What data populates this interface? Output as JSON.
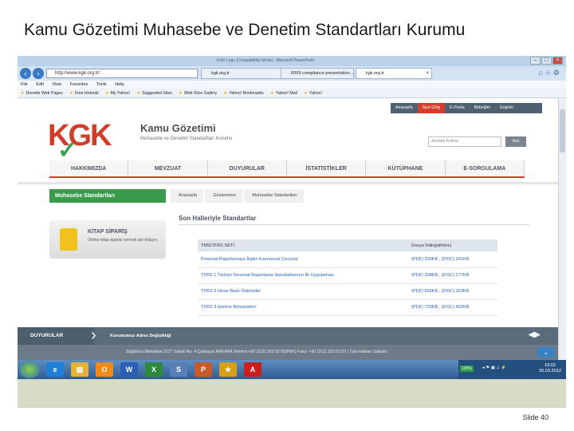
{
  "slide": {
    "title": "Kamu Gözetimi Muhasebe ve Denetim Standartları Kurumu",
    "number": "Slide 40"
  },
  "browser": {
    "window_title": "KGK Logo (Compatibility Mode) - Microsoft PowerPoint",
    "address": "http://www.kgk.org.tr/",
    "tabs": [
      {
        "label": "kgk.org.tr",
        "active": false
      },
      {
        "label": "IFRS compliance presentation...",
        "active": false
      },
      {
        "label": "kgk.org.tr",
        "active": true
      }
    ],
    "menu": [
      "File",
      "Edit",
      "View",
      "Favorites",
      "Tools",
      "Help"
    ],
    "favorites": [
      "Denetle Web Pages",
      "Free Hotmail",
      "My Yahoo!",
      "Suggested Sites",
      "Web Slice Gallery",
      "Yahoo! Bookmarks",
      "Yahoo! Mail",
      "Yahoo!"
    ]
  },
  "site": {
    "top_nav": [
      "Anasayfa",
      "Siye Gİriş",
      "E-Posta",
      "Bebeğim",
      "English"
    ],
    "logo": "KGK",
    "org_title": "Kamu Gözetimi",
    "org_subtitle": "Muhasebe ve Denetim Standartları Kurumu",
    "search_placeholder": "Anahtar Kelime",
    "search_button": "Ara",
    "main_nav": [
      "HAKKIMIZDA",
      "MEVZUAT",
      "DUYURULAR",
      "İSTATİSTİKLER",
      "KÜTÜPHANE",
      "E-SORGULAMA"
    ],
    "side_heading": "Muhasebe Standartları",
    "breadcrumbs": [
      "Anasayfa",
      "Gözlemmer",
      "Muhasebe Standartları"
    ],
    "kitap": {
      "title": "KİTAP SİPARİŞ",
      "subtitle": "Online kitap siparişi vermek için tıklayın."
    },
    "content_title": "Son Halleriyle Standartlar",
    "table": {
      "headers": [
        "TMS/TFRS SETİ",
        "Dosya İndir(pdf/doc)"
      ],
      "rows": [
        {
          "name": "Finansal Raporlamaya İlişkin Kavramsal Çerçeve",
          "size": "(PDF) 330KB , (DOC) 241KB"
        },
        {
          "name": "TFRS 1 Türkiye Finansal Raporlama Standartlarının İlk Uygulaması",
          "size": "(PDF) 338KB , (DOC) 277KB"
        },
        {
          "name": "TFRS 2 Hisse Bazlı Ödemeler",
          "size": "(PDF) 650KB , (DOC) 323KB"
        },
        {
          "name": "TFRS 3 İşletme Birleşmeleri",
          "size": "(PDF) 720KB , (DOC) 402KB"
        }
      ]
    },
    "footer": {
      "section": "DUYURULAR",
      "news": "Kurumumuz Adres Değişikliği",
      "address": "Söğütözü Mahallesi 2177 Sokak No: 4 Çankaya/ ANKARA Telefon:+90 (312) 253 55 55(PBX) Faks: +90 (312) 253 53 59 | Tüm Hakları Saklıdır."
    }
  },
  "taskbar": {
    "zoom": "100%",
    "time": "19:02",
    "date": "26.03.2012",
    "icons": [
      {
        "label": "e",
        "color": "#1f7fd6"
      },
      {
        "label": "▤",
        "color": "#e3b236"
      },
      {
        "label": "O",
        "color": "#f08a1a"
      },
      {
        "label": "W",
        "color": "#2b5fb6"
      },
      {
        "label": "X",
        "color": "#2e8a3a"
      },
      {
        "label": "S",
        "color": "#5a7fb6"
      },
      {
        "label": "P",
        "color": "#c85a2a"
      },
      {
        "label": "★",
        "color": "#d8a018"
      },
      {
        "label": "A",
        "color": "#c8201c"
      }
    ]
  }
}
